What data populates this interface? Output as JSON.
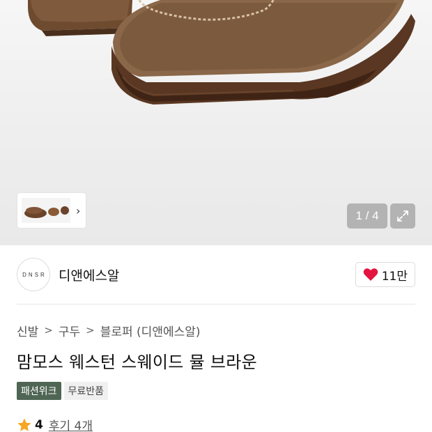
{
  "gallery": {
    "pager_text": "1 / 4",
    "thumb_more_icon": "chevron-right-icon",
    "expand_icon": "expand-icon"
  },
  "brand": {
    "logo_text": "DNSR",
    "name": "디앤에스알",
    "like_count": "11만",
    "like_icon": "heart-icon",
    "heart_color": "#e3143f"
  },
  "breadcrumb": [
    "신발",
    "구두",
    "블로퍼 (디앤에스알)"
  ],
  "product": {
    "title": "맘모스 웨스턴 스웨이드 뮬 브라운",
    "badges": {
      "fashion_week": "패션위크",
      "free_return": "무료반품"
    },
    "rating": "4",
    "review_link": "후기 4개",
    "badge_color": "#4f6654",
    "star_color": "#f5a623"
  }
}
